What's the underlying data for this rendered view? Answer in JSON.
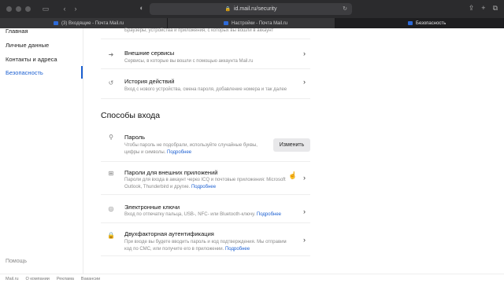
{
  "browser": {
    "url": "id.mail.ru/security",
    "tabs": [
      {
        "label": "(3) Входящие - Почта Mail.ru"
      },
      {
        "label": "Настройки - Почта Mail.ru"
      },
      {
        "label": "Безопасность"
      }
    ]
  },
  "sidebar": {
    "items": [
      {
        "label": "Главная"
      },
      {
        "label": "Личные данные"
      },
      {
        "label": "Контакты и адреса"
      },
      {
        "label": "Безопасность"
      }
    ],
    "help": "Помощь"
  },
  "main": {
    "top_rows": [
      {
        "desc": "Браузеры, устройства и приложения, с которых вы вошли в аккаунт"
      },
      {
        "title": "Внешние сервисы",
        "desc": "Сервисы, в которые вы вошли с помощью аккаунта Mail.ru",
        "icon": "arrow-right-icon"
      },
      {
        "title": "История действий",
        "desc": "Вход с нового устройства, смена пароля, добавление номера и так далее",
        "icon": "history-icon"
      }
    ],
    "section_title": "Способы входа",
    "login_rows": [
      {
        "title": "Пароль",
        "desc1": "Чтобы пароль не подобрали, используйте случайные буквы,",
        "desc2": "цифры и символы.",
        "more": "Подробнее",
        "button": "Изменить",
        "icon": "key-icon"
      },
      {
        "title": "Пароли для внешних приложений",
        "desc1": "Пароли для входа в аккаунт через ICQ и почтовые приложения: Microsoft",
        "desc2": "Outlook, Thunderbird и другие.",
        "more": "Подробнее",
        "icon": "grid-icon"
      },
      {
        "title": "Электронные ключи",
        "desc1": "Вход по отпечатку пальца, USB-, NFC- или Bluetooth-ключу.",
        "more": "Подробнее",
        "icon": "fingerprint-icon"
      },
      {
        "title": "Двухфакторная аутентификация",
        "desc1": "При входе вы будете вводить пароль и код подтверждения. Мы отправим",
        "desc2": "код по СМС, или получите его в приложении.",
        "more": "Подробнее",
        "icon": "lock-icon"
      }
    ]
  },
  "footer": {
    "links": [
      "Mail.ru",
      "О компании",
      "Реклама",
      "Вакансии"
    ]
  },
  "colors": {
    "accent": "#1b5fd1",
    "chrome": "#2b2b2d"
  }
}
